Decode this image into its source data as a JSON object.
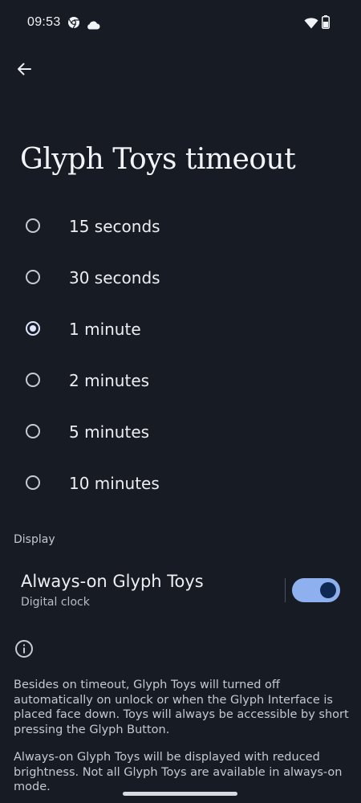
{
  "status_bar": {
    "time": "09:53",
    "icons": [
      "chrome-icon",
      "cloud-icon",
      "wifi-icon",
      "battery-icon"
    ]
  },
  "header": {
    "back_icon": "arrow-left-icon",
    "title": "Glyph Toys timeout"
  },
  "timeout_options": [
    {
      "label": "15 seconds",
      "selected": false
    },
    {
      "label": "30 seconds",
      "selected": false
    },
    {
      "label": "1 minute",
      "selected": true
    },
    {
      "label": "2 minutes",
      "selected": false
    },
    {
      "label": "5 minutes",
      "selected": false
    },
    {
      "label": "10 minutes",
      "selected": false
    }
  ],
  "display": {
    "section_label": "Display",
    "always_on": {
      "title": "Always-on Glyph Toys",
      "subtitle": "Digital clock",
      "enabled": true
    }
  },
  "info": {
    "icon": "info-icon",
    "paragraph1": "Besides on timeout, Glyph Toys will turned off automatically on unlock or when the Glyph Interface is placed face down. Toys will always be accessible by short pressing the Glyph Button.",
    "paragraph2": "Always-on Glyph Toys will be displayed with reduced brightness. Not all Glyph Toys are available in always-on mode."
  },
  "colors": {
    "background": "#171c24",
    "accent": "#8fb0ee",
    "toggle_knob": "#0f2a52"
  }
}
